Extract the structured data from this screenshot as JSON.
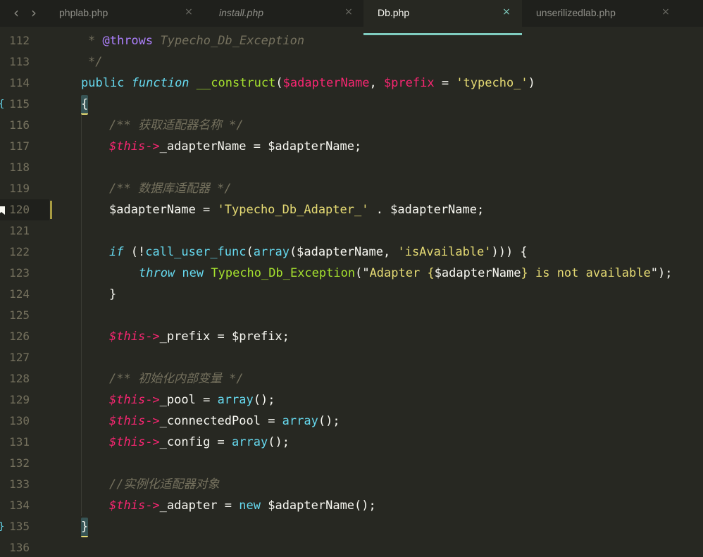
{
  "tabs": [
    {
      "label": "phplab.php",
      "active": false,
      "italic": false
    },
    {
      "label": "install.php",
      "active": false,
      "italic": true
    },
    {
      "label": "Db.php",
      "active": true,
      "italic": false
    },
    {
      "label": "unserilizedlab.php",
      "active": false,
      "italic": false
    }
  ],
  "nav": {
    "back": "‹",
    "forward": "›",
    "close": "×"
  },
  "gutter": {
    "numbers": [
      "112",
      "113",
      "114",
      "115",
      "116",
      "117",
      "118",
      "119",
      "120",
      "121",
      "122",
      "123",
      "124",
      "125",
      "126",
      "127",
      "128",
      "129",
      "130",
      "131",
      "132",
      "133",
      "134",
      "135",
      "136"
    ],
    "fold_open": "{",
    "fold_close": "}",
    "bookmark_line": "120"
  },
  "lines": [
    [
      [
        "tok-cm",
        "* "
      ],
      [
        "tok-tag",
        "@throws"
      ],
      [
        "tok-cm",
        " Typecho_Db_Exception"
      ]
    ],
    [
      [
        "tok-cm",
        "*/"
      ]
    ],
    [
      [
        "tok-kw",
        "public "
      ],
      [
        "tok-kw-i",
        "function "
      ],
      [
        "tok-fn",
        "__construct"
      ],
      [
        "tok-plain",
        "("
      ],
      [
        "tok-op",
        "$adapterName"
      ],
      [
        "tok-plain",
        ", "
      ],
      [
        "tok-op",
        "$prefix"
      ],
      [
        "tok-plain",
        " = "
      ],
      [
        "tok-str",
        "'typecho_'"
      ],
      [
        "tok-plain",
        ")"
      ]
    ],
    [
      [
        "tok-plain",
        "{"
      ]
    ],
    [
      [
        "tok-cm",
        "/** 获取适配器名称 */"
      ]
    ],
    [
      [
        "tok-var",
        "$this"
      ],
      [
        "tok-op",
        "->"
      ],
      [
        "tok-plain",
        "_adapterName = $adapterName;"
      ]
    ],
    [],
    [
      [
        "tok-cm",
        "/** 数据库适配器 */"
      ]
    ],
    [
      [
        "tok-plain",
        "$adapterName = "
      ],
      [
        "tok-str",
        "'Typecho_Db_Adapter_'"
      ],
      [
        "tok-plain",
        " . $adapterName;"
      ]
    ],
    [],
    [
      [
        "tok-kw-i",
        "if"
      ],
      [
        "tok-plain",
        " (!"
      ],
      [
        "tok-kw",
        "call_user_func"
      ],
      [
        "tok-plain",
        "("
      ],
      [
        "tok-kw",
        "array"
      ],
      [
        "tok-plain",
        "($adapterName, "
      ],
      [
        "tok-str",
        "'isAvailable'"
      ],
      [
        "tok-plain",
        "))) {"
      ]
    ],
    [
      [
        "tok-kw-i",
        "throw "
      ],
      [
        "tok-kw",
        "new "
      ],
      [
        "tok-fn",
        "Typecho_Db_Exception"
      ],
      [
        "tok-plain",
        "(\""
      ],
      [
        "tok-str",
        "Adapter {"
      ],
      [
        "tok-plain",
        "$adapterName"
      ],
      [
        "tok-str",
        "} is not available"
      ],
      [
        "tok-plain",
        "\");"
      ]
    ],
    [
      [
        "tok-plain",
        "}"
      ]
    ],
    [],
    [
      [
        "tok-var",
        "$this"
      ],
      [
        "tok-op",
        "->"
      ],
      [
        "tok-plain",
        "_prefix = $prefix;"
      ]
    ],
    [],
    [
      [
        "tok-cm",
        "/** 初始化内部变量 */"
      ]
    ],
    [
      [
        "tok-var",
        "$this"
      ],
      [
        "tok-op",
        "->"
      ],
      [
        "tok-plain",
        "_pool = "
      ],
      [
        "tok-kw",
        "array"
      ],
      [
        "tok-plain",
        "();"
      ]
    ],
    [
      [
        "tok-var",
        "$this"
      ],
      [
        "tok-op",
        "->"
      ],
      [
        "tok-plain",
        "_connectedPool = "
      ],
      [
        "tok-kw",
        "array"
      ],
      [
        "tok-plain",
        "();"
      ]
    ],
    [
      [
        "tok-var",
        "$this"
      ],
      [
        "tok-op",
        "->"
      ],
      [
        "tok-plain",
        "_config = "
      ],
      [
        "tok-kw",
        "array"
      ],
      [
        "tok-plain",
        "();"
      ]
    ],
    [],
    [
      [
        "tok-cm",
        "//实例化适配器对象"
      ]
    ],
    [
      [
        "tok-var",
        "$this"
      ],
      [
        "tok-op",
        "->"
      ],
      [
        "tok-plain",
        "_adapter = "
      ],
      [
        "tok-kw",
        "new "
      ],
      [
        "tok-plain",
        "$adapterName();"
      ]
    ],
    [
      [
        "tok-plain",
        "}"
      ]
    ],
    []
  ],
  "colors": {
    "background": "#272822",
    "tabbar": "#1f201c",
    "accent": "#7fcdc0",
    "comment": "#75715e",
    "keyword": "#66d9ef",
    "variable": "#f92672",
    "function": "#a6e22e",
    "string": "#e6db74"
  }
}
